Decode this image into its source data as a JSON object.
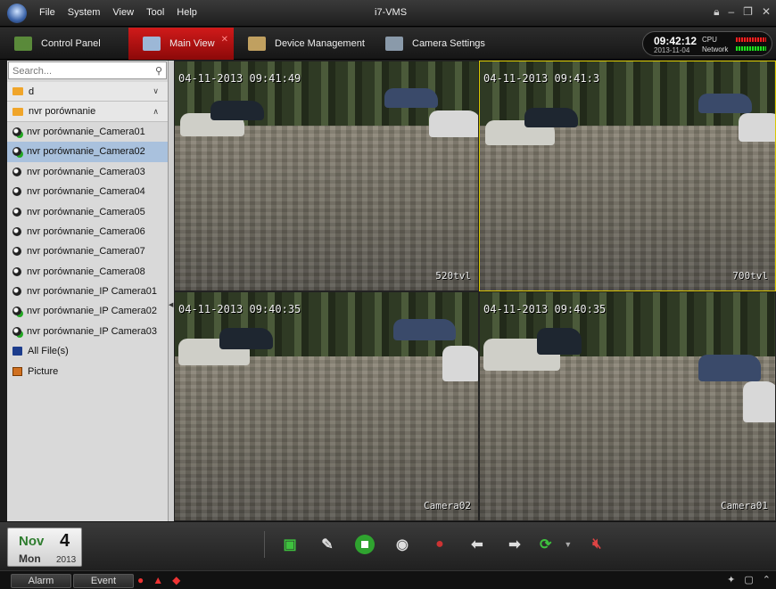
{
  "app": {
    "title": "i7-VMS"
  },
  "menu": [
    "File",
    "System",
    "View",
    "Tool",
    "Help"
  ],
  "window_controls": [
    "lock",
    "minimize",
    "restore",
    "close"
  ],
  "tabs": [
    {
      "label": "Control Panel",
      "icon": "control-panel-icon",
      "active": false
    },
    {
      "label": "Main View",
      "icon": "monitor-icon",
      "active": true
    },
    {
      "label": "Device Management",
      "icon": "device-icon",
      "active": false
    },
    {
      "label": "Camera Settings",
      "icon": "camera-settings-icon",
      "active": false
    }
  ],
  "status": {
    "time": "09:42:12",
    "date": "2013-11-04",
    "cpu_label": "CPU",
    "network_label": "Network"
  },
  "sidebar": {
    "search_placeholder": "Search...",
    "groups": [
      {
        "label": "d",
        "expanded": false
      },
      {
        "label": "nvr porównanie",
        "expanded": true
      }
    ],
    "cameras": [
      "nvr porównanie_Camera01",
      "nvr porównanie_Camera02",
      "nvr porównanie_Camera03",
      "nvr porównanie_Camera04",
      "nvr porównanie_Camera05",
      "nvr porównanie_Camera06",
      "nvr porównanie_Camera07",
      "nvr porównanie_Camera08",
      "nvr porównanie_IP Camera01",
      "nvr porównanie_IP Camera02",
      "nvr porównanie_IP Camera03"
    ],
    "selected_camera": "nvr porównanie_Camera02",
    "extras": [
      "All File(s)",
      "Picture"
    ]
  },
  "views": [
    {
      "timestamp": "04-11-2013 09:41:49",
      "label": "520tvl"
    },
    {
      "timestamp": "04-11-2013 09:41:3",
      "label": "700tvl"
    },
    {
      "timestamp": "04-11-2013 09:40:35",
      "label": "Camera02"
    },
    {
      "timestamp": "04-11-2013 09:40:35",
      "label": "Camera01"
    }
  ],
  "date": {
    "month": "Nov",
    "day": "4",
    "weekday": "Mon",
    "year": "2013"
  },
  "statusbar": {
    "alarm_label": "Alarm",
    "event_label": "Event"
  },
  "colors": {
    "accent_red": "#c81414",
    "tree_selection": "#a9c1dd",
    "date_month": "#2f7d2f"
  }
}
